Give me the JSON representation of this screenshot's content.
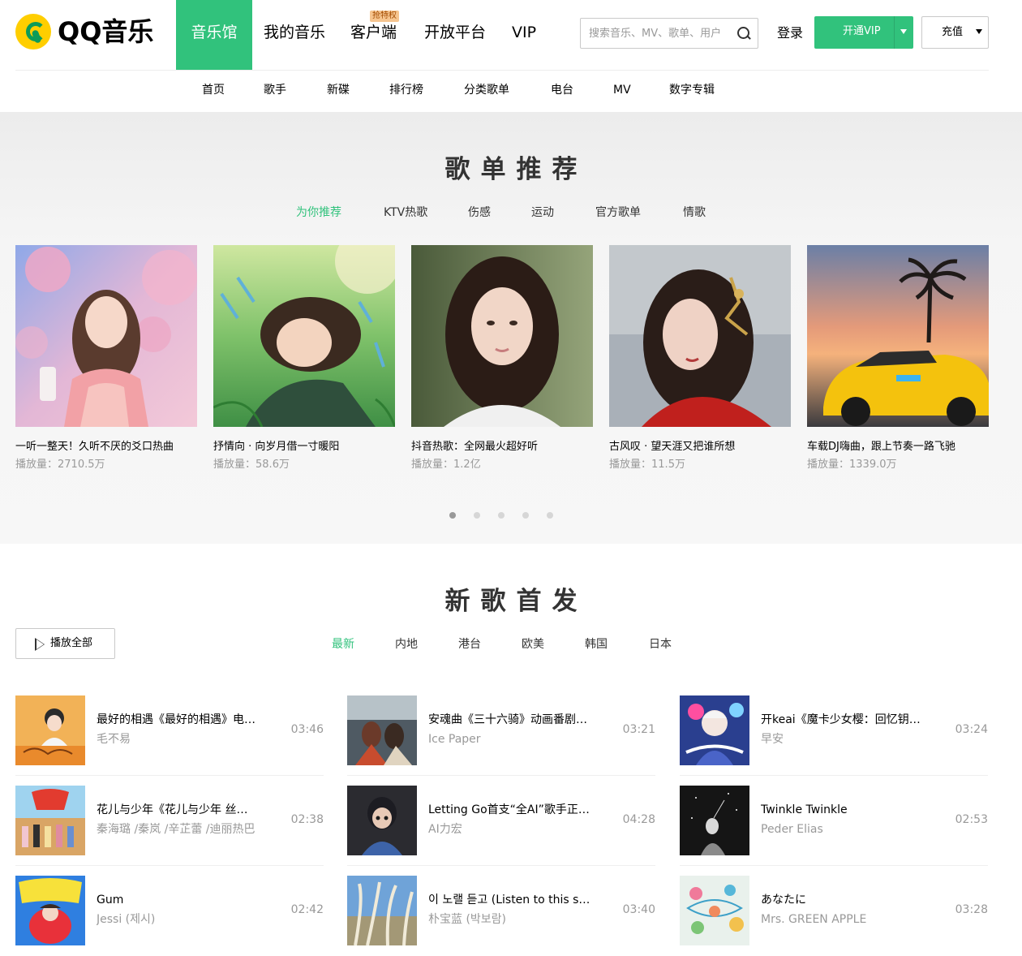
{
  "brand": {
    "name": "QQ音乐",
    "accent": "#31c27c",
    "logo_color": "#ffce00"
  },
  "topnav": [
    {
      "label": "音乐馆",
      "active": true
    },
    {
      "label": "我的音乐"
    },
    {
      "label": "客户端",
      "badge": "抢特权"
    },
    {
      "label": "开放平台"
    },
    {
      "label": "VIP"
    }
  ],
  "search": {
    "placeholder": "搜索音乐、MV、歌单、用户"
  },
  "header_actions": {
    "login": "登录",
    "vip": "开通VIP",
    "charge": "充值"
  },
  "subnav": [
    "首页",
    "歌手",
    "新碟",
    "排行榜",
    "分类歌单",
    "电台",
    "MV",
    "数字专辑"
  ],
  "playlists": {
    "title": "歌单推荐",
    "tabs": [
      "为你推荐",
      "KTV热歌",
      "伤感",
      "运动",
      "官方歌单",
      "情歌"
    ],
    "plays_label": "播放量：",
    "items": [
      {
        "title": "一听一整天！久听不厌的爻口热曲",
        "plays": "2710.5万",
        "cover": "sakura-portrait"
      },
      {
        "title": "抒情向 · 向岁月借一寸暖阳",
        "plays": "58.6万",
        "cover": "grass-illustration"
      },
      {
        "title": "抖音热歌：全网最火超好听",
        "plays": "1.2亿",
        "cover": "portrait"
      },
      {
        "title": "古风叹 · 望天涯又把谁所想",
        "plays": "11.5万",
        "cover": "hanfu-portrait"
      },
      {
        "title": "车载DJ嗨曲，跟上节奏一路飞驰",
        "plays": "1339.0万",
        "cover": "sports-car"
      }
    ],
    "pages": 5
  },
  "new_songs": {
    "title": "新歌首发",
    "play_all": "播放全部",
    "tabs": [
      "最新",
      "内地",
      "港台",
      "欧美",
      "韩国",
      "日本"
    ],
    "items": [
      {
        "name": "最好的相遇《最好的相遇》电影宣传推广曲",
        "artist": "毛不易",
        "time": "03:46"
      },
      {
        "name": "安魂曲《三十六骑》动画番剧主题曲",
        "artist": "Ice Paper",
        "time": "03:21"
      },
      {
        "name": "开keai《魔卡少女樱：回忆钥匙》",
        "artist": "早安",
        "time": "03:24"
      },
      {
        "name": "花儿与少年《花儿与少年 丝路季》",
        "artist": "秦海璐 /秦岚 /辛芷蕾 /迪丽热巴",
        "time": "02:38"
      },
      {
        "name": "Letting Go首支“全AI”歌手正式出道",
        "artist": "AI力宏",
        "time": "04:28"
      },
      {
        "name": "Twinkle Twinkle",
        "artist": "Peder Elias",
        "time": "02:53"
      },
      {
        "name": "Gum",
        "artist": "Jessi (제시)",
        "time": "02:42"
      },
      {
        "name": "이 노랠 듣고 (Listen to this song)",
        "artist": "朴宝蓝 (박보람)",
        "time": "03:40"
      },
      {
        "name": "あなたに",
        "artist": "Mrs. GREEN APPLE",
        "time": "03:28"
      }
    ]
  }
}
